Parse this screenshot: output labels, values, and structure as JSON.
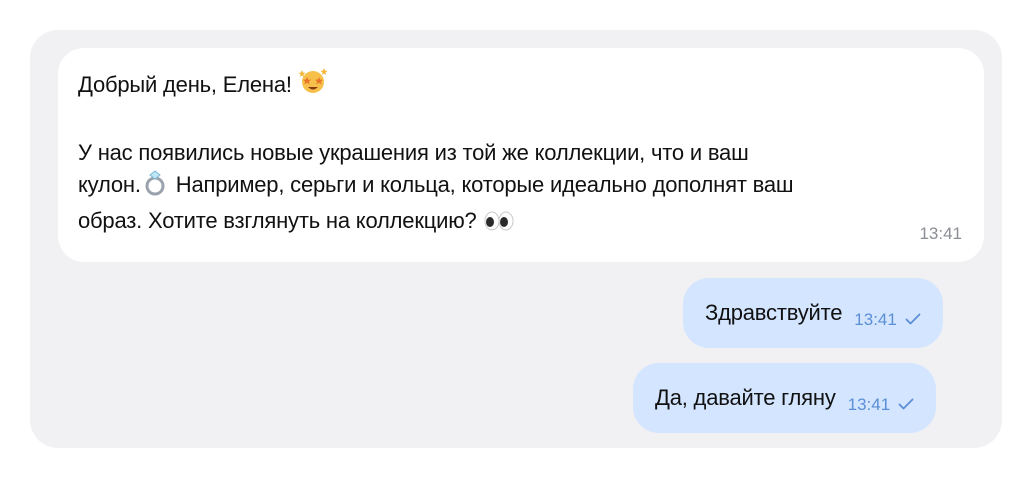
{
  "messages": {
    "incoming": {
      "greeting": "Добрый день, Елена!",
      "line1": "У нас появились новые украшения из той же коллекции, что и ваш",
      "line2a": "кулон.",
      "line2b": "Например, серьги и кольца, которые идеально дополнят ваш",
      "line3": "образ. Хотите взглянуть на коллекцию?",
      "time": "13:41",
      "emojis": [
        "star-struck-icon",
        "ring-icon",
        "eyes-icon"
      ]
    },
    "outgoing": [
      {
        "text": "Здравствуйте",
        "time": "13:41",
        "status": "sent-check-icon"
      },
      {
        "text": "Да, давайте гляну",
        "time": "13:41",
        "status": "sent-check-icon"
      }
    ]
  },
  "colors": {
    "panel_bg": "#f1f1f4",
    "incoming_bg": "#ffffff",
    "outgoing_bg": "#d4e5ff",
    "outgoing_meta": "#5a8fd6",
    "incoming_time": "#8a8d94"
  }
}
